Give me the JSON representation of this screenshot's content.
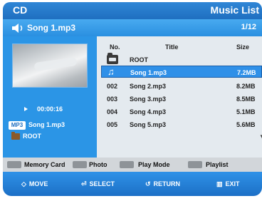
{
  "header": {
    "source": "CD",
    "title": "Music List"
  },
  "now_playing": {
    "filename": "Song 1.mp3",
    "position": "1/12",
    "icon": "speaker-icon"
  },
  "left": {
    "elapsed": "00:00:16",
    "format_badge": "MP3",
    "track": "Song 1.mp3",
    "folder": "ROOT"
  },
  "list": {
    "columns": {
      "no": "No.",
      "title": "Title",
      "size": "Size"
    },
    "folder_row": {
      "title": "ROOT"
    },
    "rows": [
      {
        "no": "",
        "title": "Song 1.mp3",
        "size": "7.2MB",
        "selected": true
      },
      {
        "no": "002",
        "title": "Song 2.mp3",
        "size": "8.2MB"
      },
      {
        "no": "003",
        "title": "Song 3.mp3",
        "size": "8.5MB"
      },
      {
        "no": "004",
        "title": "Song 4.mp3",
        "size": "5.1MB"
      },
      {
        "no": "005",
        "title": "Song 5.mp3",
        "size": "5.6MB"
      }
    ]
  },
  "color_keys": {
    "memory_card": "Memory Card",
    "photo": "Photo",
    "play_mode": "Play Mode",
    "playlist": "Playlist"
  },
  "nav": {
    "move": "MOVE",
    "select": "SELECT",
    "return": "RETURN",
    "exit": "EXIT"
  },
  "colors": {
    "accent": "#2b95e6",
    "title_bar": "#1f6fc0",
    "list_bg": "#e4eaef"
  }
}
